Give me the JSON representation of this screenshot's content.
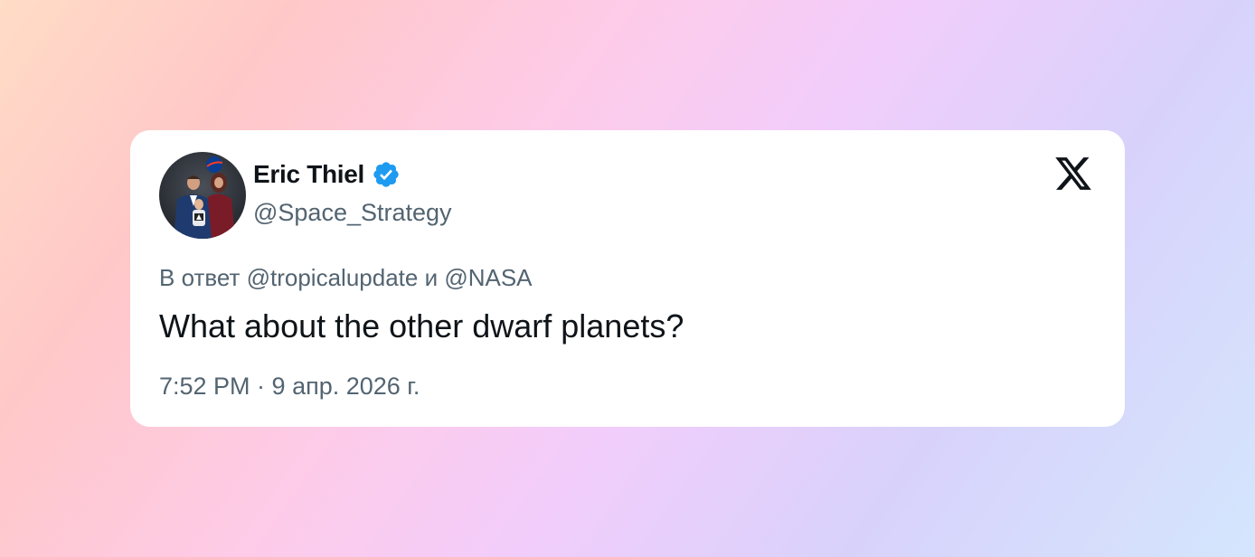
{
  "tweet": {
    "author_name": "Eric Thiel",
    "author_handle": "@Space_Strategy",
    "verified": true,
    "reply_context": "В ответ @tropicalupdate и @NASA",
    "text": "What about the other dwarf planets?",
    "timestamp": "7:52 PM · 9 апр. 2026 г."
  },
  "icons": {
    "verified": "verified-badge-icon",
    "brand": "x-logo-icon"
  },
  "colors": {
    "verified_blue": "#1d9bf0",
    "text_primary": "#0f1419",
    "text_secondary": "#536471",
    "card_background": "#ffffff"
  }
}
